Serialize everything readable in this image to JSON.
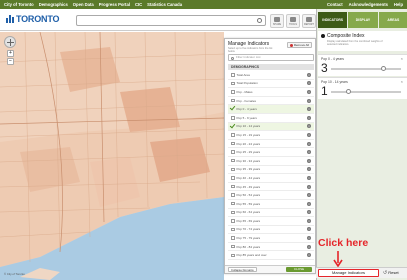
{
  "topbar": {
    "links": [
      "City of Toronto",
      "Demographics",
      "Open Data",
      "Progress Portal",
      "CIC",
      "Statistics Canada"
    ],
    "right_links": [
      "Contact",
      "Acknowledgements",
      "Help"
    ]
  },
  "header": {
    "logo_text": "TORONTO",
    "search_placeholder": "",
    "icons": [
      {
        "name": "share-icon",
        "label": "SHARE"
      },
      {
        "name": "tools-icon",
        "label": "TOOLS"
      },
      {
        "name": "report-icon",
        "label": "REPORT"
      }
    ]
  },
  "manage_panel": {
    "title": "Manage Indicators",
    "subtitle": "Select up to five indicators from the list below",
    "remove_all": "Remove All",
    "filter_placeholder": "Filter Indicator List",
    "category": "DEMOGRAPHICS",
    "indicators": [
      {
        "label": "Total Area",
        "selected": false
      },
      {
        "label": "Total Population",
        "selected": false
      },
      {
        "label": "Pop - Males",
        "selected": false
      },
      {
        "label": "Pop - Females",
        "selected": false
      },
      {
        "label": "Pop 0 - 4 years",
        "selected": true
      },
      {
        "label": "Pop 5 - 9 years",
        "selected": false
      },
      {
        "label": "Pop 10 - 14 years",
        "selected": true
      },
      {
        "label": "Pop 15 - 19 years",
        "selected": false
      },
      {
        "label": "Pop 20 - 24 years",
        "selected": false
      },
      {
        "label": "Pop 25 - 29 years",
        "selected": false
      },
      {
        "label": "Pop 30 - 34 years",
        "selected": false
      },
      {
        "label": "Pop 35 - 39 years",
        "selected": false
      },
      {
        "label": "Pop 40 - 44 years",
        "selected": false
      },
      {
        "label": "Pop 45 - 49 years",
        "selected": false
      },
      {
        "label": "Pop 50 - 54 years",
        "selected": false
      },
      {
        "label": "Pop 55 - 59 years",
        "selected": false
      },
      {
        "label": "Pop 60 - 64 years",
        "selected": false
      },
      {
        "label": "Pop 65 - 69 years",
        "selected": false
      },
      {
        "label": "Pop 70 - 74 years",
        "selected": false
      },
      {
        "label": "Pop 75 - 79 years",
        "selected": false
      },
      {
        "label": "Pop 80 - 84 years",
        "selected": false
      },
      {
        "label": "Pop 85 years and over",
        "selected": false
      }
    ],
    "collapse_label": "Collapse Domains",
    "close_label": "CLOSE"
  },
  "right_panel": {
    "tabs": [
      "INDICATORS",
      "DISPLAY",
      "AREAS"
    ],
    "composite": {
      "title": "Composite Index",
      "desc": "Display calculated from the combined weights of selected indicators."
    },
    "indicators": [
      {
        "name": "Pop 0 - 4 years",
        "weight": "3",
        "close": "×",
        "level": 0.75
      },
      {
        "name": "Pop 10 - 14 years",
        "weight": "1",
        "close": "×",
        "level": 0.25
      }
    ]
  },
  "bottom_bar": {
    "manage_label": "Manage Indicators",
    "reset_label": "Reset"
  },
  "annotation": {
    "text": "Click here"
  },
  "colors": {
    "topbar": "#5b7a2a",
    "active_tab": "#3d5a17",
    "highlight": "#e5252a"
  }
}
